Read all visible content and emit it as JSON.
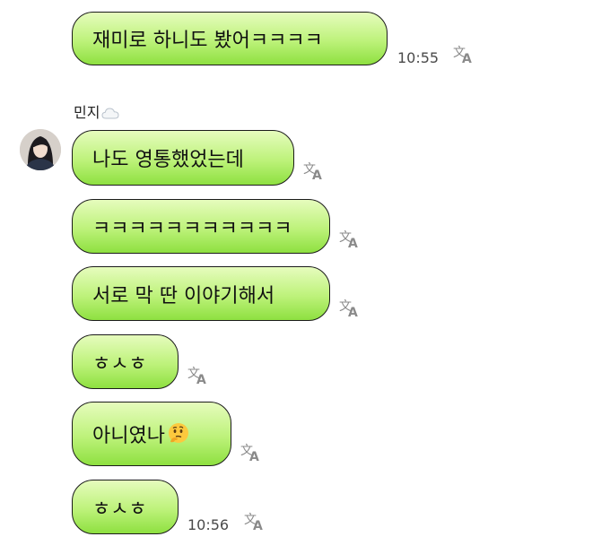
{
  "sender": {
    "name": "민지",
    "status_icon": "cloud-icon"
  },
  "messages": [
    {
      "text": "재미로 하니도 봤어ㅋㅋㅋㅋ",
      "time": "10:55"
    },
    {
      "text": "나도 영통했었는데"
    },
    {
      "text": "ㅋㅋㅋㅋㅋㅋㅋㅋㅋㅋㅋ"
    },
    {
      "text": "서로 막 딴 이야기해서"
    },
    {
      "text": "ㅎㅅㅎ"
    },
    {
      "text": "아니였나",
      "emoji": "thinking-face-icon"
    },
    {
      "text": "ㅎㅅㅎ",
      "time": "10:56"
    }
  ],
  "translate_icon": {
    "glyph_main": "文",
    "glyph_sub": "A"
  },
  "colors": {
    "bubble_top": "#e6fcbd",
    "bubble_bottom": "#8ee040",
    "bubble_border": "#1b1b1b",
    "timestamp": "#4a4a4a",
    "icon_gray": "#8a8a8a"
  }
}
